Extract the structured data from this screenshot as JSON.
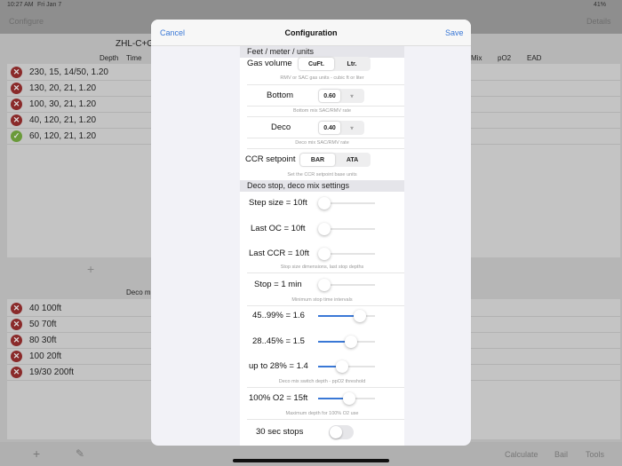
{
  "status": {
    "time": "10:27 AM",
    "date": "Fri Jan 7",
    "battery": "41%"
  },
  "nav": {
    "left": "Configure",
    "right": "Details"
  },
  "plan": {
    "title": "ZHL-C+G",
    "columns": [
      "Depth",
      "Time"
    ],
    "right_columns": [
      "Mix",
      "pO2",
      "EAD"
    ],
    "rows": [
      {
        "text": "230, 15, 14/50, 1.20",
        "status": "x"
      },
      {
        "text": "130, 20, 21, 1.20",
        "status": "x"
      },
      {
        "text": "100, 30, 21, 1.20",
        "status": "x"
      },
      {
        "text": "40, 120, 21, 1.20",
        "status": "x"
      },
      {
        "text": "60, 120, 21, 1.20",
        "status": "ok"
      }
    ],
    "add": "+"
  },
  "deco": {
    "title": "Deco m",
    "rows": [
      "40 100ft",
      "50 70ft",
      "80 30ft",
      "100 20ft",
      "19/30 200ft"
    ]
  },
  "tabbar": {
    "add": "+",
    "edit": "✎",
    "calculate": "Calculate",
    "bail": "Bail",
    "tools": "Tools"
  },
  "modal": {
    "cancel": "Cancel",
    "title": "Configuration",
    "save": "Save",
    "sec1": "Feet / meter / units",
    "gas_volume": {
      "label": "Gas volume",
      "options": [
        "CuFt.",
        "Ltr."
      ],
      "selected": "CuFt.",
      "caption": "RMV or SAC gas units - cubic ft or liter"
    },
    "bottom": {
      "label": "Bottom",
      "value": "0.60",
      "arrow": "▿",
      "caption": "Bottom mix SAC/RMV rate"
    },
    "deco": {
      "label": "Deco",
      "value": "0.40",
      "arrow": "▿",
      "caption": "Deco mix SAC/RMV rate"
    },
    "ccr": {
      "label": "CCR setpoint",
      "options": [
        "BAR",
        "ATA"
      ],
      "selected": "BAR",
      "caption": "Set the CCR setpoint base units"
    },
    "sec2": "Deco stop, deco mix settings",
    "sliders1": [
      {
        "label": "Step size = 10ft",
        "value": 0
      },
      {
        "label": "Last OC = 10ft",
        "value": 0
      },
      {
        "label": "Last CCR = 10ft",
        "value": 0
      }
    ],
    "caption_stop": "Stop size dimensions, last stop depths",
    "stop": {
      "label": "Stop = 1 min",
      "value": 0,
      "caption": "Minimum stop time intervals"
    },
    "sliders2": [
      {
        "label": "45..99% = 1.6",
        "value": 0.8
      },
      {
        "label": "28..45% = 1.5",
        "value": 0.6
      },
      {
        "label": "up to 28% = 1.4",
        "value": 0.4
      }
    ],
    "caption_switch": "Deco mix switch depth - ppO2 threshold",
    "o2": {
      "label": "100% O2 = 15ft",
      "value": 0.55,
      "caption": "Maximum depth for 100% O2 use"
    },
    "thirty": {
      "label": "30 sec stops",
      "on": false
    }
  },
  "colors": {
    "accent": "#3a78d6"
  }
}
